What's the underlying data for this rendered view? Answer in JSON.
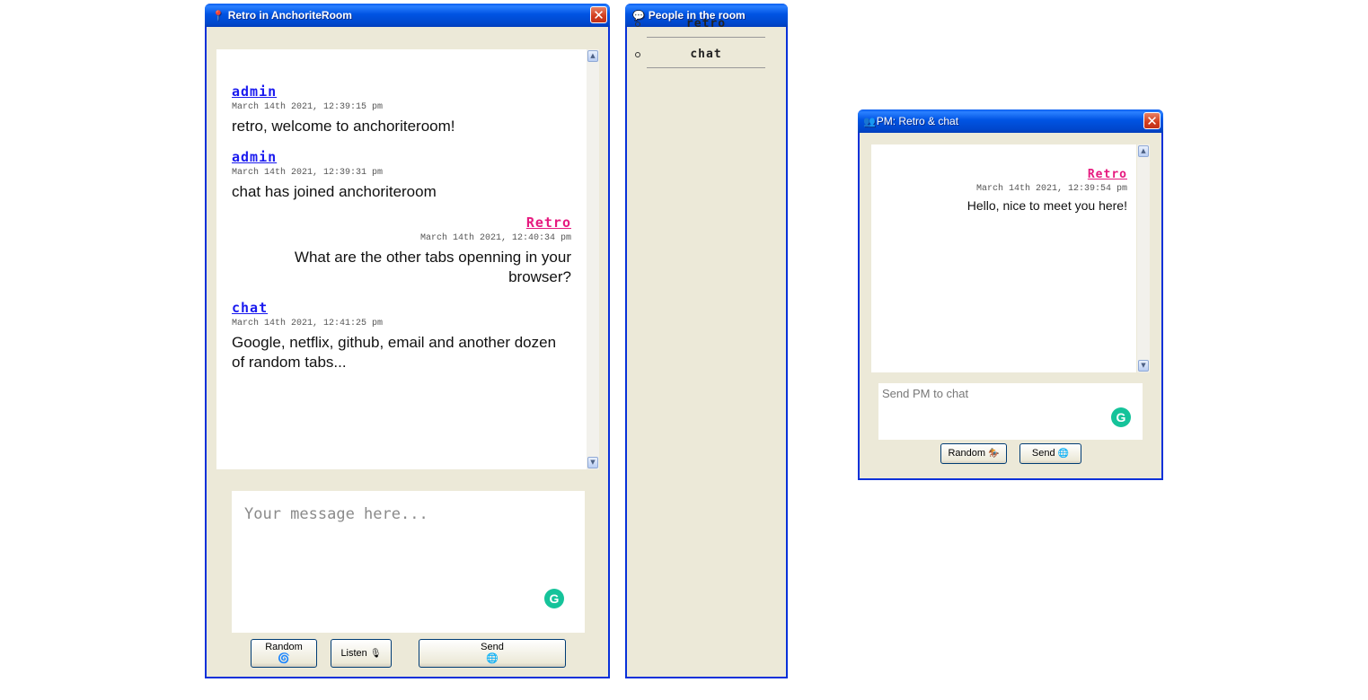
{
  "main_window": {
    "title": "Retro in AnchoriteRoom",
    "title_icon": "pin-icon",
    "close_glyph": "✕",
    "messages": [
      {
        "user": "admin",
        "timestamp": "March 14th 2021, 12:39:15 pm",
        "text": "retro, welcome to anchoriteroom!"
      },
      {
        "user": "admin",
        "timestamp": "March 14th 2021, 12:39:31 pm",
        "text": "chat has joined anchoriteroom"
      },
      {
        "user": "Retro",
        "timestamp": "March 14th 2021, 12:40:34 pm",
        "text": "What are the other tabs openning in your browser?"
      },
      {
        "user": "chat",
        "timestamp": "March 14th 2021, 12:41:25 pm",
        "text": "Google, netflix, github, email and another dozen of random tabs..."
      }
    ],
    "input_placeholder": "Your message here...",
    "buttons": {
      "random_label": "Random",
      "random_icon": "🌀",
      "listen_label": "Listen",
      "listen_icon": "🎙",
      "send_label": "Send",
      "send_icon": "🌐"
    }
  },
  "people_window": {
    "title": "People in the room",
    "title_icon": "speech-bubble-icon",
    "people": [
      "retro",
      "chat"
    ]
  },
  "pm_window": {
    "title": "PM: Retro & chat",
    "title_icon": "people-icon",
    "close_glyph": "✕",
    "messages": [
      {
        "user": "Retro",
        "timestamp": "March 14th 2021, 12:39:54 pm",
        "text": "Hello, nice to meet you here!"
      }
    ],
    "input_placeholder": "Send PM to chat",
    "buttons": {
      "random_label": "Random",
      "random_icon": "🏇",
      "send_label": "Send",
      "send_icon": "🌐"
    }
  },
  "grammarly_glyph": "G",
  "colors": {
    "title_blue": "#0054e3",
    "window_bg": "#ece9d8",
    "user_link": "#1a1aef",
    "self_user": "#e6197f",
    "grammarly": "#15c39a"
  }
}
